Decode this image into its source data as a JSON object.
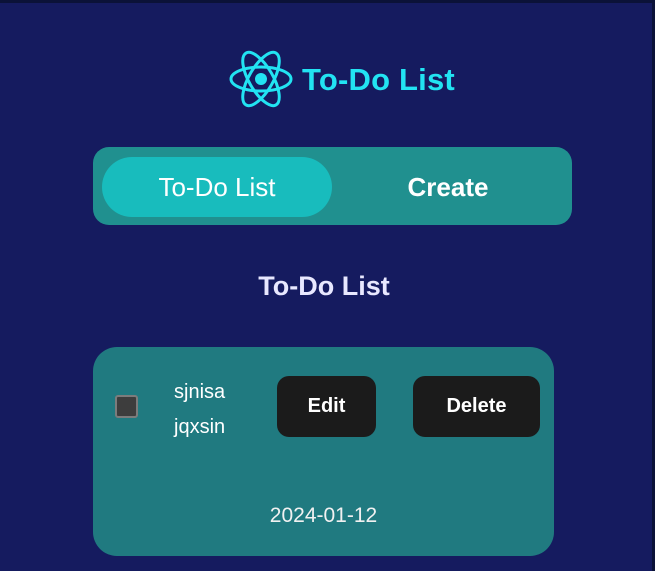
{
  "app": {
    "title": "To-Do List",
    "logo_icon": "react-atom-icon",
    "accent_color": "#22e3f2",
    "background_color": "#151b5f"
  },
  "tabs": [
    {
      "label": "To-Do List",
      "active": true
    },
    {
      "label": "Create",
      "active": false
    }
  ],
  "section": {
    "title": "To-Do List"
  },
  "todos": [
    {
      "text": "sjnisa jqxsin",
      "checked": false,
      "date": "2024-01-12",
      "edit_label": "Edit",
      "delete_label": "Delete"
    }
  ]
}
